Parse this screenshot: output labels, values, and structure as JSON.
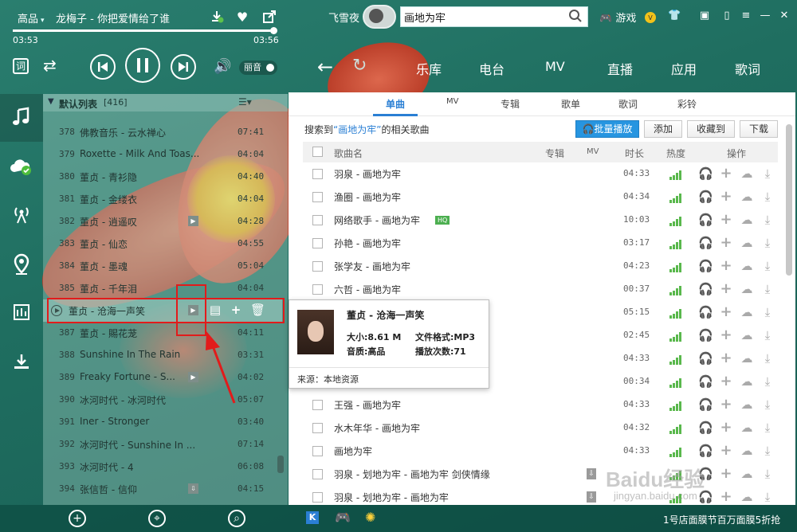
{
  "player": {
    "quality": "高品",
    "now_playing": "龙梅子 - 你把爱情给了谁",
    "time_current": "03:53",
    "time_total": "03:56",
    "progress_fraction": 0.99,
    "lyric_btn": "词",
    "lyric_mode": "丽音"
  },
  "header": {
    "username": "飞雪夜",
    "search_value": "画地为牢",
    "game_label": "游戏"
  },
  "nav": {
    "tabs": [
      "乐库",
      "电台",
      "MV",
      "直播",
      "应用",
      "歌词"
    ]
  },
  "playlist": {
    "name": "默认列表",
    "count": "[416]",
    "rows": [
      {
        "num": "378",
        "title": "佛教音乐 - 云水禅心",
        "dur": "07:41"
      },
      {
        "num": "379",
        "title": "Roxette - Milk And Toas...",
        "dur": "04:04"
      },
      {
        "num": "380",
        "title": "董贞 - 青衫隐",
        "dur": "04:40"
      },
      {
        "num": "381",
        "title": "董贞 - 金缕衣",
        "dur": "04:04"
      },
      {
        "num": "382",
        "title": "董贞 - 逍遥叹",
        "dur": "04:28"
      },
      {
        "num": "383",
        "title": "董贞 - 仙恋",
        "dur": "04:55"
      },
      {
        "num": "384",
        "title": "董贞 - 墨魂",
        "dur": "05:04"
      },
      {
        "num": "385",
        "title": "董贞 - 千年泪",
        "dur": "04:04"
      },
      {
        "num": "",
        "title": "董贞 - 沧海一声笑",
        "dur": ""
      },
      {
        "num": "387",
        "title": "董贞 - 賜花茏",
        "dur": "04:11"
      },
      {
        "num": "388",
        "title": "Sunshine In The Rain",
        "dur": "03:31"
      },
      {
        "num": "389",
        "title": "Freaky Fortune - S...",
        "dur": "04:02"
      },
      {
        "num": "390",
        "title": "冰河时代 - 冰河时代",
        "dur": "05:07"
      },
      {
        "num": "391",
        "title": "Iner - Stronger",
        "dur": "03:40"
      },
      {
        "num": "392",
        "title": "冰河时代 - Sunshine In ...",
        "dur": "07:14"
      },
      {
        "num": "393",
        "title": "冰河时代 - 4",
        "dur": "06:08"
      },
      {
        "num": "394",
        "title": "张信哲 - 信仰",
        "dur": "04:15"
      }
    ]
  },
  "content": {
    "subtabs": [
      "单曲",
      "MV",
      "专辑",
      "歌单",
      "歌词",
      "彩铃"
    ],
    "summary_prefix": "搜索到",
    "summary_keyword": "“画地为牢”",
    "summary_suffix": "的相关歌曲",
    "buttons": {
      "batch_play": "批量播放",
      "add": "添加",
      "collect": "收藏到",
      "download": "下载"
    },
    "columns": {
      "name": "歌曲名",
      "album": "专辑",
      "mv": "MV",
      "duration": "时长",
      "heat": "热度",
      "ops": "操作"
    },
    "rows": [
      {
        "name": "羽泉 - 画地为牢",
        "dur": "04:33"
      },
      {
        "name": "渔圈 - 画地为牢",
        "dur": "04:34"
      },
      {
        "name": "网络歌手 - 画地为牢",
        "dur": "10:03",
        "hq": "HQ"
      },
      {
        "name": "孙艳 - 画地为牢",
        "dur": "03:17"
      },
      {
        "name": "张学友 - 画地为牢",
        "dur": "04:23"
      },
      {
        "name": "六哲 - 画地为牢",
        "dur": "00:37"
      },
      {
        "name": "",
        "dur": "05:15"
      },
      {
        "name": "",
        "dur": "02:45"
      },
      {
        "name": "",
        "dur": "04:33"
      },
      {
        "name": "",
        "dur": "00:34"
      },
      {
        "name": "王强 - 画地为牢",
        "dur": "04:33"
      },
      {
        "name": "水木年华 - 画地为牢",
        "dur": "04:32"
      },
      {
        "name": "画地为牢",
        "dur": "04:33"
      },
      {
        "name": "羽泉 - 划地为牢 - 画地为牢 剑侠情缘",
        "dur": ""
      },
      {
        "name": "羽泉 - 划地为牢 - 画地为牢",
        "dur": ""
      }
    ]
  },
  "tooltip": {
    "title": "董贞 - 沧海一声笑",
    "size": "大小:8.61 M",
    "format": "文件格式:MP3",
    "quality": "音质:高品",
    "plays": "播放次数:71",
    "source": "来源：本地资源"
  },
  "footer": {
    "ad": "1号店面膜节百万面膜5折抢"
  },
  "watermark": {
    "logo": "Baidu经验",
    "url": "jingyan.baidu.com"
  },
  "colors": {
    "accent": "#2a7fd4",
    "annotation_red": "#e21b1b",
    "heat_green": "#59b84c"
  }
}
